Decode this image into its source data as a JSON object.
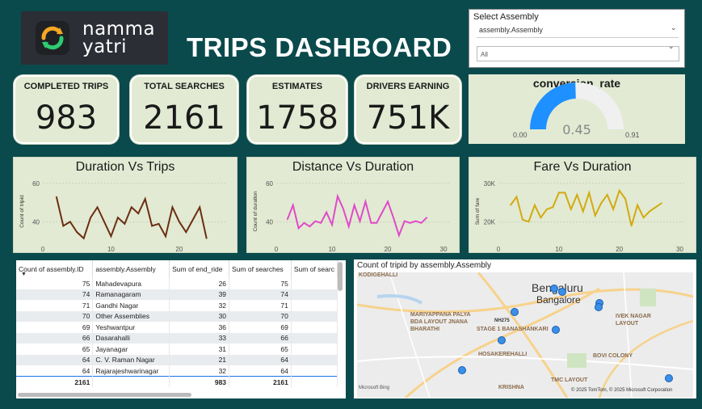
{
  "logo": {
    "line1": "namma",
    "line2": "yatri"
  },
  "title": "TRIPS DASHBOARD",
  "slicer": {
    "title": "Select Assembly",
    "field": "assembly.Assembly",
    "selected": "All"
  },
  "kpis": [
    {
      "label": "COMPLETED TRIPS",
      "value": "983"
    },
    {
      "label": "TOTAL SEARCHES",
      "value": "2161"
    },
    {
      "label": "ESTIMATES",
      "value": "1758"
    },
    {
      "label": "DRIVERS EARNING",
      "value": "751K"
    }
  ],
  "gauge": {
    "title": "conversion_rate",
    "min": "0.00",
    "max": "0.91",
    "value": "0.45",
    "fraction": 0.49,
    "accent": "#1e90ff"
  },
  "chart_data": [
    {
      "type": "line",
      "title": "Duration Vs Trips",
      "ylabel": "Count of tripid",
      "xlabel": "",
      "color": "#6b2e12",
      "xlim": [
        0,
        27
      ],
      "ylim": [
        30,
        60
      ],
      "yticks": [
        "40",
        "60"
      ],
      "xticks": [
        "0",
        "10",
        "20"
      ],
      "x": [
        2,
        3,
        4,
        5,
        6,
        7,
        8,
        9,
        10,
        11,
        12,
        13,
        14,
        15,
        16,
        17,
        18,
        19,
        20,
        21,
        22,
        23,
        24
      ],
      "y": [
        52,
        38,
        40,
        35,
        32,
        42,
        47,
        40,
        33,
        42,
        39,
        47,
        44,
        51,
        38,
        39,
        33,
        47,
        40,
        35,
        41,
        47,
        32
      ]
    },
    {
      "type": "line",
      "title": "Distance Vs Duration",
      "ylabel": "Count of duration",
      "xlabel": "",
      "color": "#e04ac8",
      "xlim": [
        0,
        31
      ],
      "ylim": [
        25,
        60
      ],
      "yticks": [
        "40",
        "60"
      ],
      "xticks": [
        "0",
        "10",
        "20",
        "30"
      ],
      "x": [
        2,
        3,
        4,
        5,
        6,
        7,
        8,
        9,
        10,
        11,
        12,
        13,
        14,
        15,
        16,
        17,
        18,
        19,
        20,
        21,
        22,
        23,
        24,
        25,
        26,
        27
      ],
      "y": [
        38,
        46,
        33,
        36,
        34,
        37,
        36,
        42,
        35,
        51,
        44,
        34,
        46,
        37,
        48,
        36,
        36,
        42,
        48,
        39,
        29,
        37,
        36,
        37,
        36,
        39
      ],
      "xlim_note": ""
    },
    {
      "type": "line",
      "title": "Fare Vs Duration",
      "ylabel": "Sum of fare",
      "xlabel": "",
      "color": "#d2aa10",
      "xlim": [
        0,
        31
      ],
      "ylim": [
        10,
        40
      ],
      "yticks": [
        "20K",
        "30K"
      ],
      "xticks": [
        "0",
        "10",
        "20",
        "30"
      ],
      "x": [
        2,
        3,
        4,
        5,
        6,
        7,
        8,
        9,
        10,
        11,
        12,
        13,
        14,
        15,
        16,
        17,
        18,
        19,
        20,
        21,
        22,
        23,
        24,
        25,
        26,
        27
      ],
      "y": [
        28,
        32,
        21,
        20,
        28,
        22,
        26,
        27,
        34,
        34,
        26,
        33,
        25,
        34,
        23,
        29,
        33,
        26,
        35,
        31,
        18,
        28,
        22,
        25,
        27,
        29
      ]
    }
  ],
  "table": {
    "columns": [
      "Count of assembly.ID",
      "assembly.Assembly",
      "Sum of end_ride",
      "Sum of searches",
      "Sum of searc"
    ],
    "rows": [
      [
        "75",
        "Mahadevapura",
        "26",
        "75",
        ""
      ],
      [
        "74",
        "Ramanagaram",
        "39",
        "74",
        ""
      ],
      [
        "71",
        "Gandhi Nagar",
        "32",
        "71",
        ""
      ],
      [
        "70",
        "Other Assemblies",
        "30",
        "70",
        ""
      ],
      [
        "69",
        "Yeshwantpur",
        "36",
        "69",
        ""
      ],
      [
        "66",
        "Dasarahalli",
        "33",
        "66",
        ""
      ],
      [
        "65",
        "Jayanagar",
        "31",
        "65",
        ""
      ],
      [
        "64",
        "C. V. Raman Nagar",
        "21",
        "64",
        ""
      ],
      [
        "64",
        "Rajarajeshwarinagar",
        "32",
        "64",
        ""
      ]
    ],
    "total": [
      "2161",
      "",
      "983",
      "2161",
      ""
    ]
  },
  "map": {
    "title": "Count of tripid by assembly.Assembly",
    "city": "Bengaluru",
    "city_alt": "Bangalore",
    "labels": [
      "KODIGEHALLI",
      "MARIYAPPANA PALYA BDA LAYOUT JNANA BHARATHI",
      "STAGE 1 BANASHANKARI",
      "NH275",
      "HOSAKEREHALLI",
      "IVEK NAGAR LAYOUT",
      "BOVI COLONY",
      "TMC LAYOUT",
      "KRISHNA"
    ],
    "copyright": "© 2025 TomTom, © 2025 Microsoft Corporation",
    "attribution": "Microsoft Bing"
  }
}
